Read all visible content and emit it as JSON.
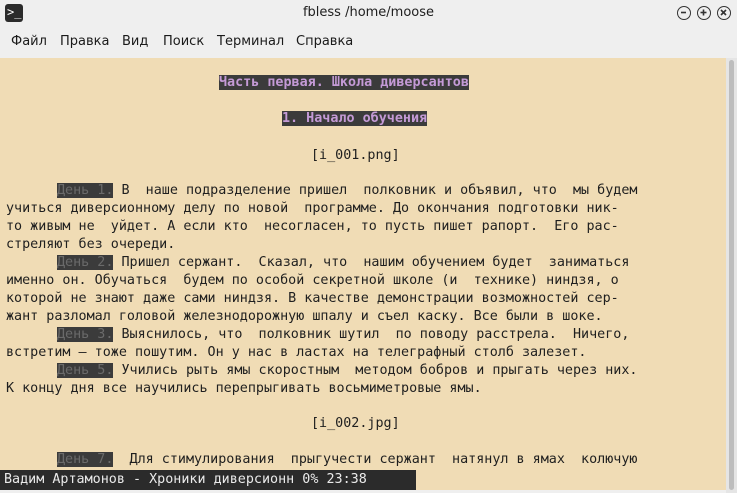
{
  "window": {
    "title": "fbless /home/moose",
    "app_icon": "terminal-icon"
  },
  "menu": [
    "Файл",
    "Правка",
    "Вид",
    "Поиск",
    "Терминал",
    "Справка"
  ],
  "text": {
    "part_title": "Часть первая. Школа диверсантов",
    "chapter_title": "1. Начало обучения",
    "img1": "[i_001.png]",
    "day1_label": "День 1.",
    "day1_l1": " В  наше подразделение пришел  полковник и объявил, что  мы будем",
    "day1_l2": "учиться диверсионному делу по новой  программе. До окончания подготовки ник-",
    "day1_l3": "то живым не  уйдет. А если кто  несогласен, то пусть пишет рапорт.  Его рас-",
    "day1_l4": "стреляют без очереди.",
    "day2_label": "День 2.",
    "day2_l1": " Пришел сержант.  Сказал, что  нашим обучением будет  заниматься",
    "day2_l2": "именно он. Обучаться  будем по особой секретной школе (и  технике) ниндзя, о",
    "day2_l3": "которой не знают даже сами ниндзя. В качестве демонстрации возможностей сер-",
    "day2_l4": "жант разломал головой железнодорожную шпалу и съел каску. Все были в шоке.",
    "day3_label": "День 3.",
    "day3_l1": " Выяснилось, что  полковник шутил  по поводу расстрела.  Ничего,",
    "day3_l2": "встретим — тоже пошутим. Он у нас в ластах на телеграфный столб залезет.",
    "day5_label": "День 5.",
    "day5_l1": " Учились рыть ямы скоростным  методом бобров и прыгать через них.",
    "day5_l2": "К концу дня все научились перепрыгивать восьмиметровые ямы.",
    "img2": "[i_002.jpg]",
    "day7_label": "День 7.",
    "day7_l1": "  Для стимулирования  прыгучести сержант  натянул в ямах  колючую"
  },
  "status_bar": "Вадим Артамонов - Хроники диверсионн 0% 23:38",
  "colors": {
    "background": "#f0dcb5",
    "highlight_bg": "#3b3b3b",
    "title_fg": "#c49ad6"
  }
}
